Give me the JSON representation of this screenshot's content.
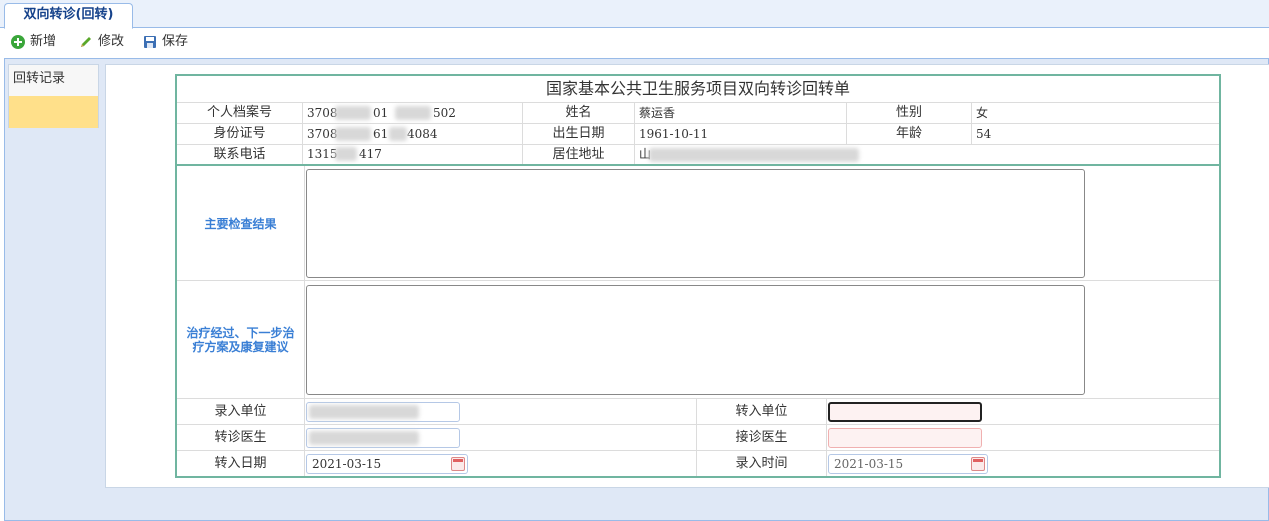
{
  "tab": {
    "label": "双向转诊(回转)"
  },
  "toolbar": {
    "add": "新增",
    "edit": "修改",
    "save": "保存"
  },
  "sidebar": {
    "title": "回转记录"
  },
  "form": {
    "title": "国家基本公共卫生服务项目双向转诊回转单",
    "file_no_label": "个人档案号",
    "file_no_parts": [
      "3708",
      "01",
      "502"
    ],
    "name_label": "姓名",
    "name_value": "蔡运香",
    "gender_label": "性别",
    "gender_value": "女",
    "id_label": "身份证号",
    "id_parts": [
      "3708",
      "61",
      "4084"
    ],
    "birth_label": "出生日期",
    "birth_value": "1961-10-11",
    "age_label": "年龄",
    "age_value": "54",
    "phone_label": "联系电话",
    "phone_parts": [
      "1315",
      "417"
    ],
    "address_label": "居住地址",
    "address_value": "山",
    "exam_label": "主要检查结果",
    "treatment_label": "治疗经过、下一步治疗方案及康复建议",
    "entry_unit_label": "录入单位",
    "transfer_unit_label": "转入单位",
    "referral_doctor_label": "转诊医生",
    "receiving_doctor_label": "接诊医生",
    "transfer_date_label": "转入日期",
    "transfer_date_value": "2021-03-15",
    "entry_time_label": "录入时间",
    "entry_time_value": "2021-03-15"
  },
  "colors": {
    "accent": "#3a7fd5",
    "border": "#70b5a0",
    "selected": "#ffe08a",
    "error": "#f0b0b0"
  }
}
